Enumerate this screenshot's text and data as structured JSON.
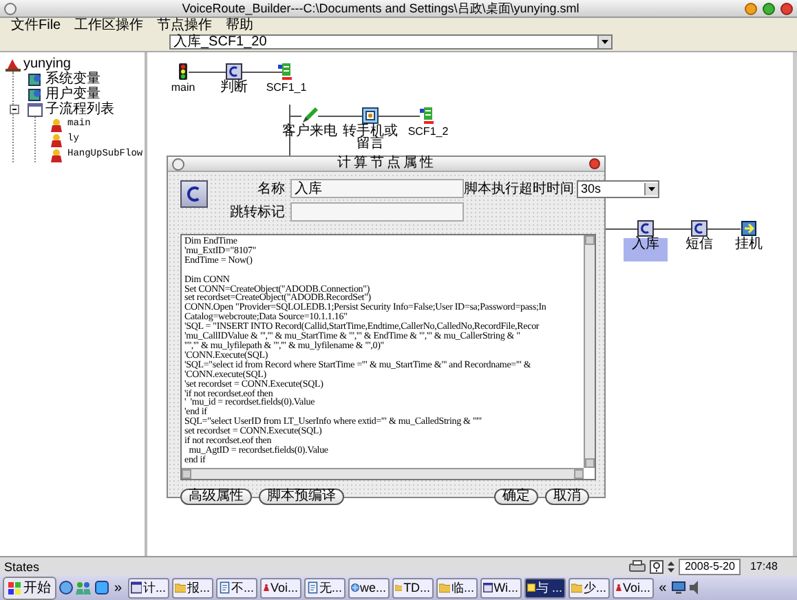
{
  "window": {
    "title": "VoiceRoute_Builder---C:\\Documents and Settings\\吕政\\桌面\\yunying.sml"
  },
  "menu": [
    "文件File",
    "工作区操作",
    "节点操作",
    "帮助"
  ],
  "flow_selector": {
    "value": "入库_SCF1_20"
  },
  "tree": {
    "label": "yunying",
    "kind": "project",
    "children": [
      {
        "label": "系统变量",
        "kind": "variables"
      },
      {
        "label": "用户变量",
        "kind": "variables"
      },
      {
        "label": "子流程列表",
        "kind": "list",
        "expanded": true,
        "children": [
          {
            "label": "main",
            "kind": "flow"
          },
          {
            "label": "ly",
            "kind": "flow"
          },
          {
            "label": "HangUpSubFlow",
            "kind": "flow"
          }
        ]
      }
    ]
  },
  "nodes": [
    {
      "label": "main",
      "kind": "start",
      "selected": false
    },
    {
      "label": "判断",
      "kind": "calc",
      "selected": false
    },
    {
      "label": "SCF1_1",
      "kind": "subflow",
      "selected": false
    },
    {
      "label": "客户来电",
      "kind": "call",
      "selected": false
    },
    {
      "label": "转手机或留言",
      "kind": "transfer",
      "selected": false
    },
    {
      "label": "SCF1_2",
      "kind": "subflow",
      "selected": false
    },
    {
      "label": "入库",
      "kind": "calc",
      "selected": true
    },
    {
      "label": "短信",
      "kind": "calc",
      "selected": false
    },
    {
      "label": "挂机",
      "kind": "hangup",
      "selected": false
    }
  ],
  "dialog": {
    "title": "计算节点属性",
    "name_label": "名称",
    "name_value": "入库",
    "timeout_label": "脚本执行超时时间",
    "timeout_value": "30s",
    "jump_label": "跳转标记",
    "script": "Dim EndTime\n'mu_ExtID=\"8107\"\nEndTime = Now()\n\nDim CONN\nSet CONN=CreateObject(\"ADODB.Connection\")\nset recordset=CreateObject(\"ADODB.RecordSet\")\nCONN.Open \"Provider=SQLOLEDB.1;Persist Security Info=False;User ID=sa;Password=pass;In\nCatalog=webcroute;Data Source=10.1.1.16\"\n'SQL = \"INSERT INTO Record(Callid,StartTime,Endtime,CallerNo,CalledNo,RecordFile,Recor\n'mu_CallIDValue & \"','\" & mu_StartTime & \"','\" & EndTime & \"','\" & mu_CallerString & \"\n'\"','\" & mu_lyfilepath & \"','\" & mu_lyfilename & \"',0)\"\n'CONN.Execute(SQL)\n'SQL=\"select id from Record where StartTime ='\" & mu_StartTime &\"' and Recordname='\" &\n'CONN.execute(SQL)\n'set recordset = CONN.Execute(SQL)\n'if not recordset.eof then\n'  'mu_id = recordset.fields(0).Value\n'end if\nSQL=\"select UserID from LT_UserInfo where extid='\" & mu_CalledString & \"'\"\nset recordset = CONN.Execute(SQL)\nif not recordset.eof then\n  mu_AgtID = recordset.fields(0).Value\nend if",
    "left_buttons": [
      "高级属性",
      "脚本预编译"
    ],
    "right_buttons": [
      "确定",
      "取消"
    ]
  },
  "status_bar": {
    "text": "States",
    "date": "2008-5-20",
    "time": "17:48"
  },
  "taskbar": {
    "start": "开始",
    "more": "»",
    "tasks": [
      {
        "label": "计...",
        "kind": "window",
        "selected": false
      },
      {
        "label": "报...",
        "kind": "folder",
        "selected": false
      },
      {
        "label": "不...",
        "kind": "document",
        "selected": false
      },
      {
        "label": "Voi...",
        "kind": "app",
        "selected": false
      },
      {
        "label": "无...",
        "kind": "document",
        "selected": false
      },
      {
        "label": "we...",
        "kind": "globe",
        "selected": false
      },
      {
        "label": "TD...",
        "kind": "folder",
        "selected": false
      },
      {
        "label": "临...",
        "kind": "folder",
        "selected": false
      },
      {
        "label": "Wi...",
        "kind": "window",
        "selected": false
      },
      {
        "label": "与 ...",
        "kind": "note",
        "selected": true
      },
      {
        "label": "少...",
        "kind": "folder",
        "selected": false
      },
      {
        "label": "Voi...",
        "kind": "app",
        "selected": false
      }
    ],
    "tray_toggle": "«"
  }
}
